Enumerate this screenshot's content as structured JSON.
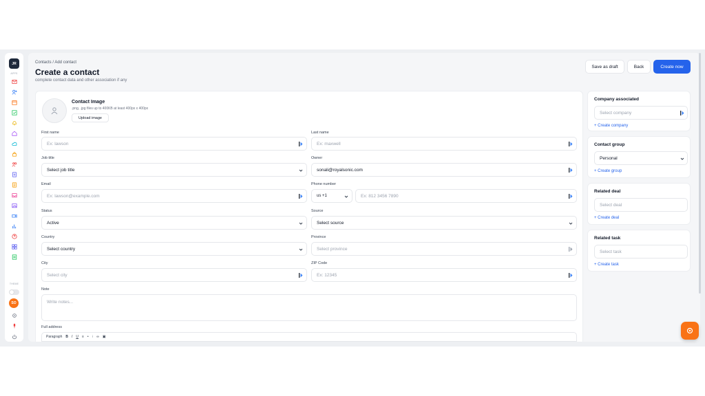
{
  "sidebar": {
    "logo": "JR",
    "apps_label": "APPS",
    "theme_label": "THEME",
    "user_initials": "SO",
    "icons": [
      "mail-icon",
      "add-user-icon",
      "calendar-icon",
      "checklist-icon",
      "bell-icon",
      "home-icon",
      "cloud-icon",
      "lock-icon",
      "team-icon",
      "document-icon",
      "notes-icon",
      "inbox-icon",
      "image-icon",
      "video-icon",
      "chart-icon",
      "help-icon",
      "grid-icon",
      "file-icon"
    ],
    "bottom_icons": [
      "settings-icon",
      "mic-icon",
      "power-icon"
    ]
  },
  "header": {
    "breadcrumb": "Contacts / Add contact",
    "title": "Create a contact",
    "subtitle": "complete contact data and other association if any",
    "save_draft_label": "Save as draft",
    "back_label": "Back",
    "create_label": "Create now"
  },
  "contact_image": {
    "title": "Contact Image",
    "hint": ".png, .jpg files up to 400KB at least 400px x 400px",
    "upload_label": "Upload image"
  },
  "form": {
    "first_name": {
      "label": "First name",
      "placeholder": "Ex: lawson"
    },
    "last_name": {
      "label": "Last name",
      "placeholder": "Ex: maxwell"
    },
    "job_title": {
      "label": "Job title",
      "value": "Select job title"
    },
    "owner": {
      "label": "Owner",
      "value": "sonali@royalsonic.com"
    },
    "email": {
      "label": "Email",
      "placeholder": "Ex: lawson@example.com"
    },
    "phone": {
      "label": "Phone number",
      "country_code": "us +1",
      "placeholder": "Ex: 812 3456 7890"
    },
    "status": {
      "label": "Status",
      "value": "Active"
    },
    "source": {
      "label": "Source",
      "value": "Select source"
    },
    "country": {
      "label": "Country",
      "value": "Select country"
    },
    "province": {
      "label": "Province",
      "placeholder": "Select province"
    },
    "city": {
      "label": "City",
      "placeholder": "Select city"
    },
    "zip": {
      "label": "ZIP Code",
      "placeholder": "Ex: 12345"
    },
    "note": {
      "label": "Note",
      "placeholder": "Write notes..."
    },
    "address": {
      "label": "Full address",
      "toolbar_paragraph": "Paragraph",
      "toolbar_bold": "B",
      "toolbar_italic": "I",
      "toolbar_underline": "U"
    }
  },
  "side_panels": {
    "company": {
      "title": "Company associated",
      "placeholder": "Select company",
      "link": "+ Create company"
    },
    "group": {
      "title": "Contact group",
      "value": "Personal",
      "link": "+ Create group"
    },
    "deal": {
      "title": "Related deal",
      "placeholder": "Select deal",
      "link": "+ Create deal"
    },
    "task": {
      "title": "Related task",
      "placeholder": "Select task",
      "link": "+ Create task"
    }
  },
  "colors": {
    "primary": "#2563eb",
    "accent": "#f97316",
    "sidebar_logo": "#1e293b"
  }
}
